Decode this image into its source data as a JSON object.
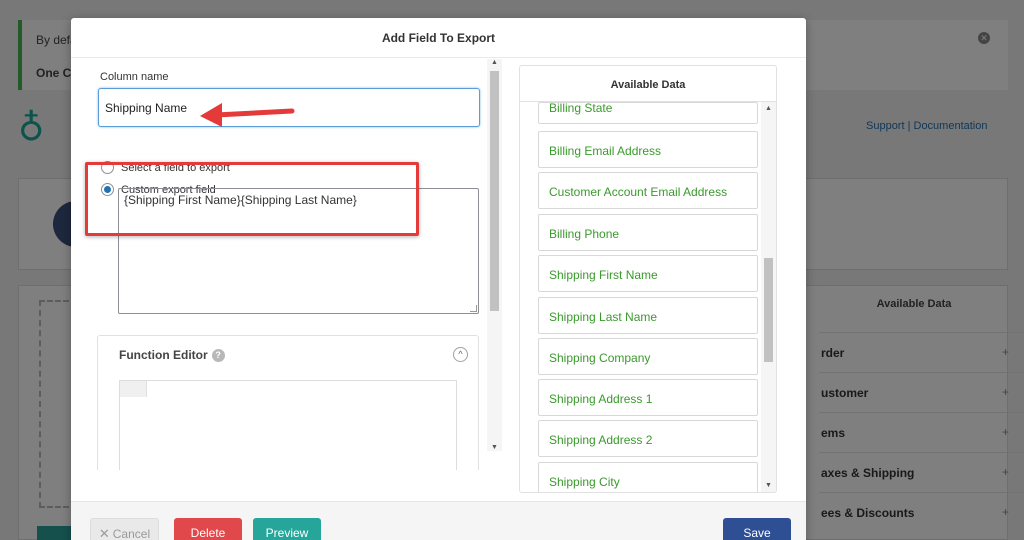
{
  "background": {
    "notice_line1": "By defa",
    "notice_line2": "One Cl",
    "support_links": "Support | Documentation",
    "available_data_title": "Available Data",
    "sections": [
      {
        "label": "rder",
        "expand": "+"
      },
      {
        "label": "ustomer",
        "expand": "+"
      },
      {
        "label": "ems",
        "expand": "+"
      },
      {
        "label": "axes & Shipping",
        "expand": "+"
      },
      {
        "label": "ees & Discounts",
        "expand": "+"
      }
    ]
  },
  "modal": {
    "title": "Add Field To Export",
    "column_name_label": "Column name",
    "column_name_value": "Shipping Name",
    "radio_select_label": "Select a field to export",
    "radio_custom_label": "Custom export field",
    "custom_field_value": "{Shipping First Name}{Shipping Last Name}",
    "function_editor_title": "Function Editor",
    "help_glyph": "?",
    "collapse_glyph": "^",
    "available_data_title": "Available Data",
    "fields": [
      "Billing State",
      "Billing Email Address",
      "Customer Account Email Address",
      "Billing Phone",
      "Shipping First Name",
      "Shipping Last Name",
      "Shipping Company",
      "Shipping Address 1",
      "Shipping Address 2",
      "Shipping City"
    ],
    "buttons": {
      "cancel": "Cancel",
      "delete": "Delete",
      "preview": "Preview",
      "save": "Save"
    }
  },
  "colors": {
    "field_text": "#3a9a2c",
    "delete": "#e0484b",
    "preview": "#26a69a",
    "save": "#2e4f93",
    "highlight": "#e53a3a"
  }
}
